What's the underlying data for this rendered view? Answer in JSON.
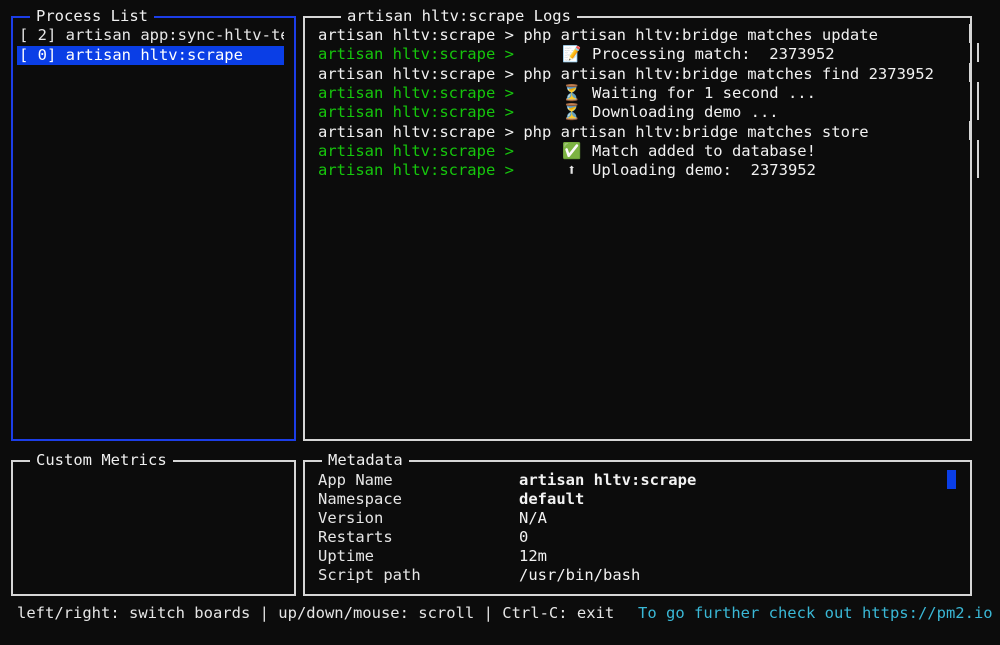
{
  "process_list": {
    "title": "Process List",
    "items": [
      {
        "label": "[ 2] artisan app:sync-hltv-te",
        "selected": false
      },
      {
        "label": "[ 0] artisan hltv:scrape",
        "selected": true
      }
    ]
  },
  "logs": {
    "title": "artisan hltv:scrape Logs",
    "lines": [
      {
        "prefix": "artisan hltv:scrape > ",
        "prefix_color": "white",
        "icon": "",
        "text": "php artisan hltv:bridge matches update"
      },
      {
        "prefix": "artisan hltv:scrape > ",
        "prefix_color": "green",
        "icon": "📝",
        "text": "Processing match:  2373952"
      },
      {
        "prefix": "artisan hltv:scrape > ",
        "prefix_color": "white",
        "icon": "",
        "text": "php artisan hltv:bridge matches find 2373952"
      },
      {
        "prefix": "artisan hltv:scrape > ",
        "prefix_color": "green",
        "icon": "⏳",
        "text": "Waiting for 1 second ..."
      },
      {
        "prefix": "artisan hltv:scrape > ",
        "prefix_color": "green",
        "icon": "⏳",
        "text": "Downloading demo ..."
      },
      {
        "prefix": "artisan hltv:scrape > ",
        "prefix_color": "white",
        "icon": "",
        "text": "php artisan hltv:bridge matches store"
      },
      {
        "prefix": "artisan hltv:scrape > ",
        "prefix_color": "green",
        "icon": "✅",
        "text": "Match added to database!"
      },
      {
        "prefix": "artisan hltv:scrape > ",
        "prefix_color": "green",
        "icon": "⬆",
        "text": "Uploading demo:  2373952"
      }
    ]
  },
  "custom_metrics": {
    "title": "Custom Metrics"
  },
  "metadata": {
    "title": "Metadata",
    "rows": [
      {
        "key": "App Name",
        "value": "artisan hltv:scrape"
      },
      {
        "key": "Namespace",
        "value": "default"
      },
      {
        "key": "Version",
        "value": "N/A"
      },
      {
        "key": "Restarts",
        "value": "0"
      },
      {
        "key": "Uptime",
        "value": "12m"
      },
      {
        "key": "Script path",
        "value": "/usr/bin/bash"
      }
    ]
  },
  "footer": {
    "help": "left/right: switch boards | up/down/mouse: scroll | Ctrl-C: exit",
    "link": "To go further check out https://pm2.io"
  },
  "colors": {
    "background": "#0c0c0c",
    "border": "#d6d6d6",
    "focus_border": "#1c3ee8",
    "selection": "#0a3ee6",
    "log_prefix_green": "#16c60c",
    "footer_link": "#3ab8d6"
  }
}
